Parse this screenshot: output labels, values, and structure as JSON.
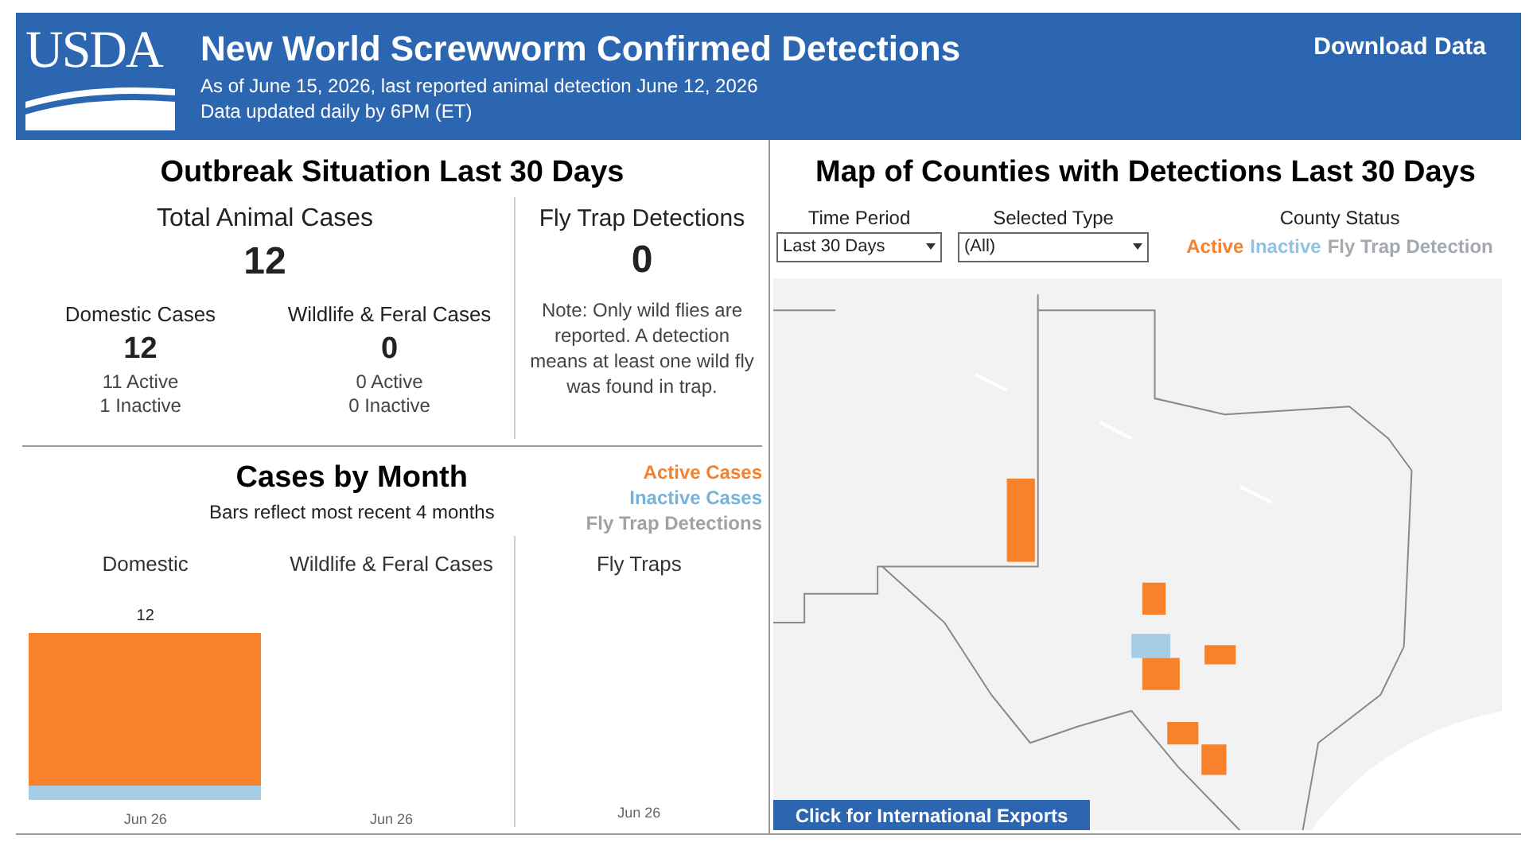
{
  "header": {
    "title": "New World Screwworm Confirmed Detections",
    "subtitle_lines": [
      "As of June 15, 2026, last reported animal detection June 12, 2026",
      "Data updated daily by 6PM (ET)"
    ],
    "logo_text": "USDA",
    "download_link": "Download Data"
  },
  "outbreak": {
    "title": "Outbreak Situation Last 30 Days",
    "total": {
      "label": "Total Animal Cases",
      "value": "12"
    },
    "groups": [
      {
        "label": "Domestic Cases",
        "value": "12",
        "lines": [
          "11 Active",
          "1 Inactive"
        ]
      },
      {
        "label": "Wildlife & Feral Cases",
        "value": "0",
        "lines": [
          "0 Active",
          "0 Inactive"
        ]
      }
    ],
    "fly_trap": {
      "label": "Fly Trap Detections",
      "value": "0",
      "note": "Note: Only wild flies are reported. A detection means at least one wild fly was found in trap."
    }
  },
  "cases_by_month": {
    "title": "Cases by Month",
    "subtitle": "Bars reflect most recent 4 months",
    "legend": [
      {
        "label": "Active Cases",
        "color": "#f8812b"
      },
      {
        "label": "Inactive Cases",
        "color": "#74b3db"
      },
      {
        "label": "Fly Trap Detections",
        "color": "#9ea3a8"
      }
    ],
    "panels": [
      {
        "title": "Domestic",
        "month": "Jun 26",
        "total_label": "12",
        "segments": [
          {
            "kind": "inactive",
            "color": "#a5cde6"
          },
          {
            "kind": "active",
            "color": "#f8812b"
          }
        ]
      },
      {
        "title": "Wildlife & Feral Cases",
        "month": "Jun 26"
      },
      {
        "title": "Fly Traps",
        "month": "Jun 26"
      }
    ]
  },
  "map": {
    "title": "Map of Counties with Detections Last 30 Days",
    "filters": [
      {
        "label": "Time Period",
        "value": "Last 30 Days"
      },
      {
        "label": "Selected Type",
        "value": "(All)"
      }
    ],
    "status_legend": {
      "label": "County Status",
      "items": [
        {
          "label": "Active",
          "color": "#f8812b"
        },
        {
          "label": "Inactive",
          "color": "#8ec3e6"
        },
        {
          "label": "Fly Trap Detection",
          "color": "#a3a9ae"
        }
      ]
    },
    "exports_button": "Click for International Exports"
  }
}
